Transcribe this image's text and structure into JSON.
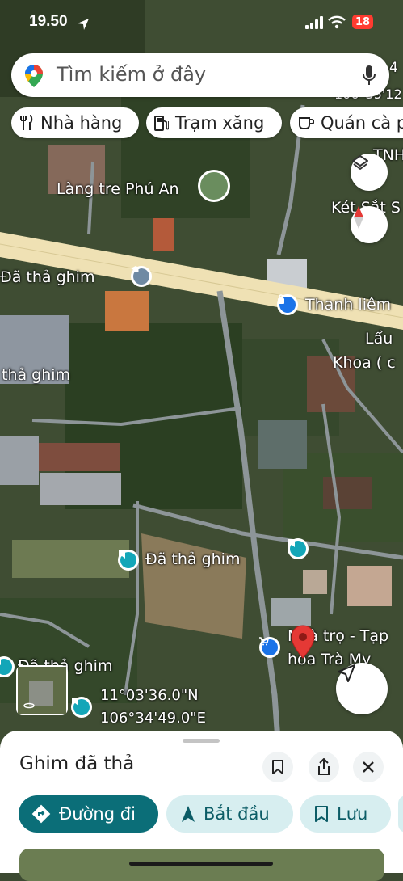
{
  "status_bar": {
    "time": "19.50",
    "battery": "18"
  },
  "search": {
    "placeholder": "Tìm kiếm ở đây"
  },
  "chips": [
    {
      "label": "Nhà hàng",
      "icon": "restaurant-icon"
    },
    {
      "label": "Trạm xăng",
      "icon": "gas-station-icon"
    },
    {
      "label": "Quán cà p",
      "icon": "coffee-icon"
    }
  ],
  "map": {
    "labels": {
      "lang_tre": "Làng tre Phú An",
      "pin_1": "Đã thả ghim",
      "pin_2": "thả ghim",
      "pin_3": "Đã thả ghim",
      "pin_4": "Đã thả ghim",
      "thanh_liem": "Thanh liêm",
      "lau": "Lẩu",
      "khoa": "Khoa ( c",
      "ket_sat": "Két Sắt S",
      "tnh": "TNH",
      "nha_tro_1": "Nhà trọ - Tạp",
      "nha_tro_2": "hóa Trà My",
      "top_right_1": "4",
      "top_right_2": "106°35'12"
    },
    "coordinates": {
      "lat": "11°03'36.0\"N",
      "lng": "106°34'49.0\"E"
    }
  },
  "sheet": {
    "title": "Ghim đã thả",
    "actions": {
      "directions": "Đường đi",
      "start": "Bắt đầu",
      "save": "Lưu"
    }
  },
  "colors": {
    "accent": "#0b6e78",
    "accent_light": "#d7eef0",
    "pin_red": "#e53935",
    "pin_teal": "#13a6b8",
    "shopping_blue": "#1a73e8"
  }
}
